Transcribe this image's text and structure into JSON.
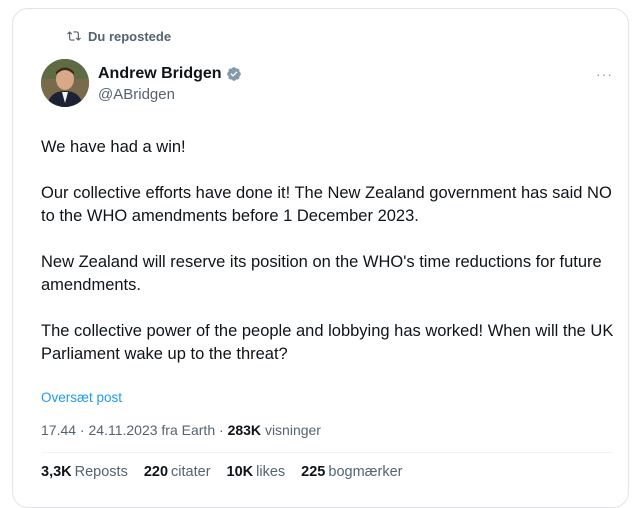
{
  "repost": {
    "label": "Du repostede",
    "icon": "repost-icon"
  },
  "author": {
    "display_name": "Andrew Bridgen",
    "handle": "@ABridgen",
    "verified_icon": "verified-badge-icon"
  },
  "more_icon": "more-icon",
  "post": {
    "paragraphs": [
      "We have had a win!",
      "Our collective efforts have done it! The New Zealand government has said NO to the WHO amendments before 1 December 2023.",
      "New Zealand will reserve its position on the WHO's time reductions for future amendments.",
      "The collective power of the people and lobbying has worked! When will the UK Parliament wake up to the threat?"
    ]
  },
  "translate_label": "Oversæt post",
  "meta": {
    "time": "17.44",
    "date": "24.11.2023",
    "source": "fra Earth",
    "views_count": "283K",
    "views_label": "visninger"
  },
  "stats": [
    {
      "count": "3,3K",
      "label": "Reposts"
    },
    {
      "count": "220",
      "label": "citater"
    },
    {
      "count": "10K",
      "label": "likes"
    },
    {
      "count": "225",
      "label": "bogmærker"
    }
  ],
  "colors": {
    "accent": "#1d9bf0",
    "secondary_text": "#536471",
    "primary_text": "#0f1419"
  }
}
